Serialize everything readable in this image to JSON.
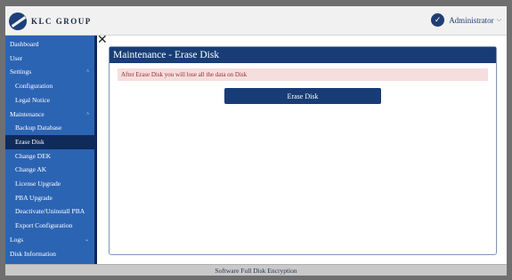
{
  "brand": {
    "name": "KLC GROUP"
  },
  "header": {
    "user_label": "Administrator",
    "user_icon": "shield-check-icon",
    "caret": "⌵"
  },
  "sidebar": {
    "items": [
      {
        "label": "Dashboard",
        "level": 0,
        "expandable": false,
        "active": false
      },
      {
        "label": "User",
        "level": 0,
        "expandable": false,
        "active": false
      },
      {
        "label": "Settings",
        "level": 0,
        "expandable": true,
        "caret": "^",
        "active": false
      },
      {
        "label": "Configuration",
        "level": 1,
        "expandable": false,
        "active": false
      },
      {
        "label": "Legal Notice",
        "level": 1,
        "expandable": false,
        "active": false
      },
      {
        "label": "Maintenance",
        "level": 0,
        "expandable": true,
        "caret": "^",
        "active": false
      },
      {
        "label": "Backup Database",
        "level": 1,
        "expandable": false,
        "active": false
      },
      {
        "label": "Erase Disk",
        "level": 1,
        "expandable": false,
        "active": true
      },
      {
        "label": "Change DEK",
        "level": 1,
        "expandable": false,
        "active": false
      },
      {
        "label": "Change AK",
        "level": 1,
        "expandable": false,
        "active": false
      },
      {
        "label": "License Upgrade",
        "level": 1,
        "expandable": false,
        "active": false
      },
      {
        "label": "PBA Upgrade",
        "level": 1,
        "expandable": false,
        "active": false
      },
      {
        "label": "Deactivate/Uninstall PBA",
        "level": 1,
        "expandable": false,
        "active": false
      },
      {
        "label": "Export Configuration",
        "level": 1,
        "expandable": false,
        "active": false
      },
      {
        "label": "Logs",
        "level": 0,
        "expandable": true,
        "caret": "⌄",
        "active": false
      },
      {
        "label": "Disk Information",
        "level": 0,
        "expandable": false,
        "active": false
      }
    ]
  },
  "close_glyph": "✕",
  "main": {
    "title": "Maintenance - Erase Disk",
    "warning": "After Erase Disk you will lose all the data on Disk",
    "erase_button": "Erase Disk"
  },
  "footer": {
    "text": "Software Full Disk Encryption"
  },
  "colors": {
    "nav_bg": "#2c64b4",
    "active_bg": "#0f2b59",
    "header_bg": "#183d76",
    "warning_bg": "#f5dede"
  }
}
